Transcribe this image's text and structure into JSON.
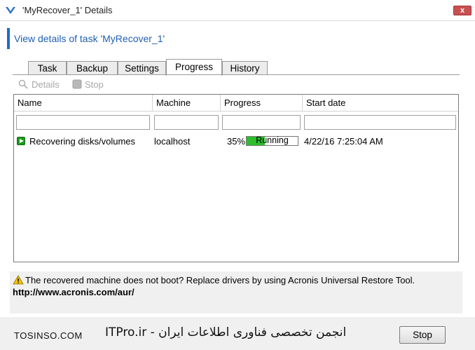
{
  "window": {
    "title": "'MyRecover_1' Details",
    "close_label": "x"
  },
  "header": {
    "title": "View details of task 'MyRecover_1'"
  },
  "tabs": [
    {
      "label": "Task",
      "active": false
    },
    {
      "label": "Backup",
      "active": false
    },
    {
      "label": "Settings",
      "active": false
    },
    {
      "label": "Progress",
      "active": true
    },
    {
      "label": "History",
      "active": false
    }
  ],
  "toolbar": {
    "details_label": "Details",
    "stop_label": "Stop"
  },
  "table": {
    "columns": [
      "Name",
      "Machine",
      "Progress",
      "Start date"
    ],
    "rows": [
      {
        "name": "Recovering disks/volumes",
        "machine": "localhost",
        "progress_percent": "35%",
        "progress_value": 35,
        "status": "Running",
        "start_date": "4/22/16 7:25:04 AM"
      }
    ]
  },
  "info": {
    "message": "The recovered machine does not boot? Replace drivers by using Acronis Universal Restore Tool.",
    "link": "http://www.acronis.com/aur/"
  },
  "footer": {
    "left_text": "TOSINSO.COM",
    "center_text": "ITPro.ir - انجمن تخصصی فناوری اطلاعات ایران",
    "stop_button": "Stop"
  },
  "colors": {
    "accent": "#1e6cc2",
    "progress": "#2dbd2d",
    "close": "#c75050"
  }
}
